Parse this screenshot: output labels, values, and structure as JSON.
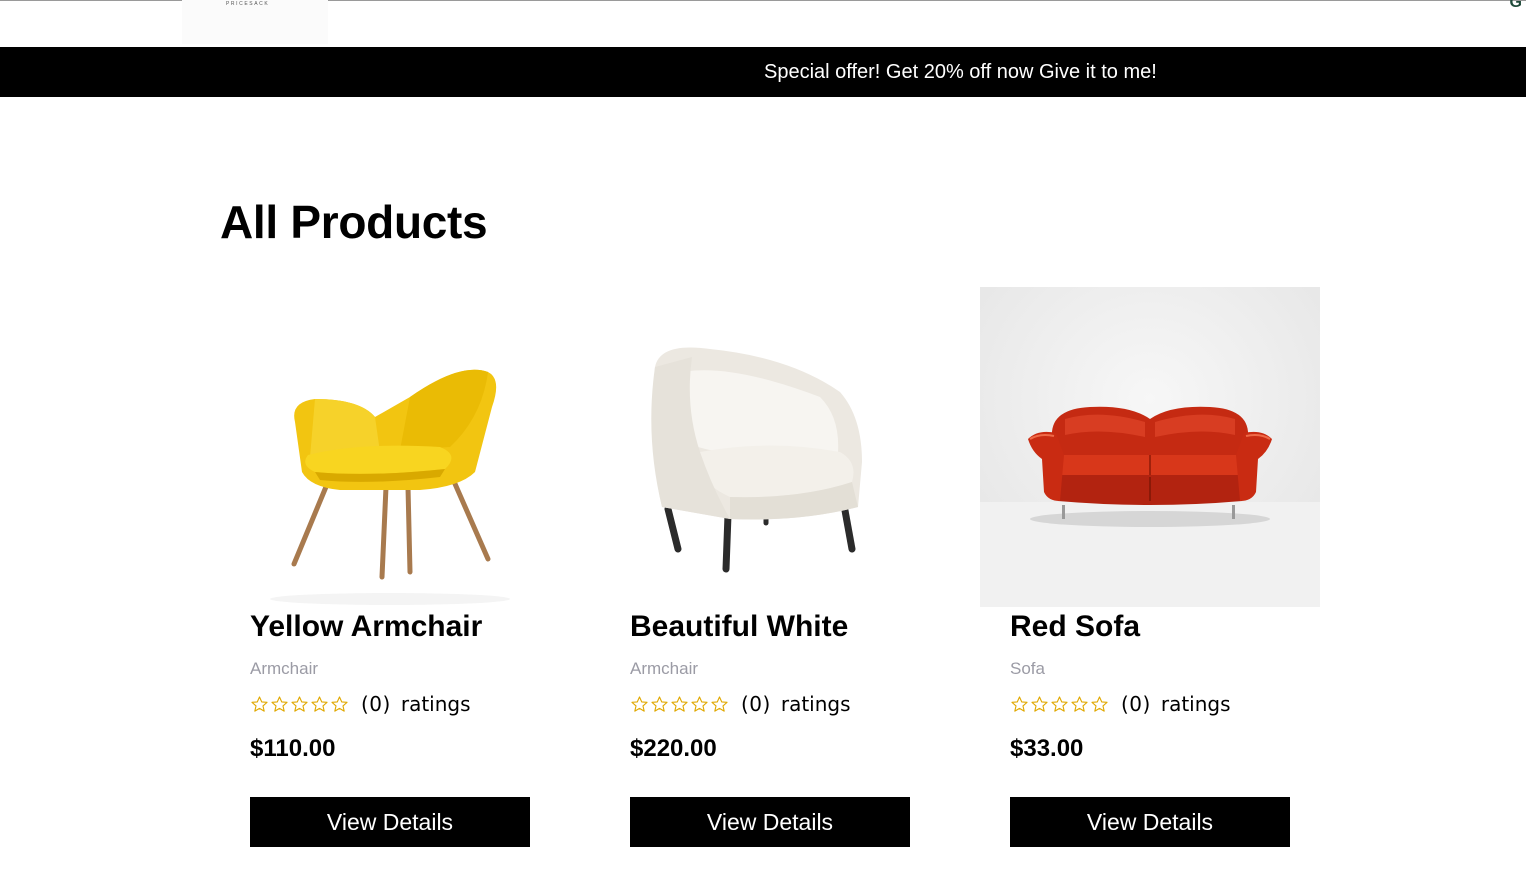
{
  "header": {
    "logo_text": "PRICESACK",
    "corner_glyph": "G"
  },
  "banner": {
    "text": "Special offer! Get 20% off now Give it to me!"
  },
  "page_title": "All Products",
  "products": [
    {
      "name": "Yellow Armchair",
      "category": "Armchair",
      "rating_count": "(0)",
      "rating_label": "ratings",
      "rating_value": 0,
      "price": "$110.00",
      "button_label": "View Details",
      "image_icon": "yellow-armchair-image"
    },
    {
      "name": "Beautiful White",
      "category": "Armchair",
      "rating_count": "(0)",
      "rating_label": "ratings",
      "rating_value": 0,
      "price": "$220.00",
      "button_label": "View Details",
      "image_icon": "white-armchair-image"
    },
    {
      "name": "Red Sofa",
      "category": "Sofa",
      "rating_count": "(0)",
      "rating_label": "ratings",
      "rating_value": 0,
      "price": "$33.00",
      "button_label": "View Details",
      "image_icon": "red-sofa-image"
    }
  ],
  "colors": {
    "banner_bg": "#000000",
    "button_bg": "#000000",
    "star_outline": "#e0a800",
    "category_text": "#9b9ba5"
  }
}
